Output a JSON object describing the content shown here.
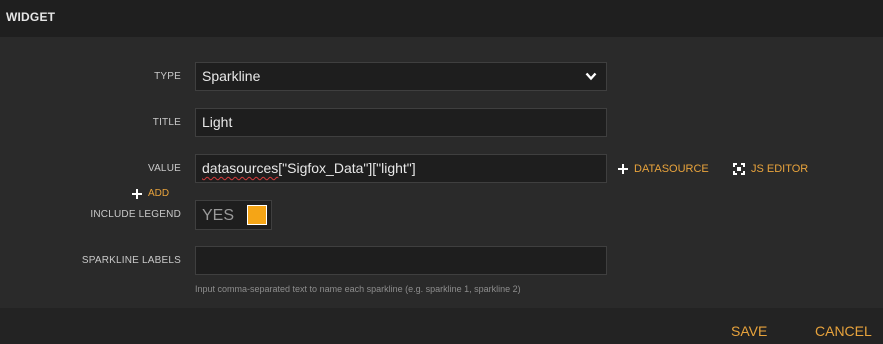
{
  "header": {
    "title": "WIDGET"
  },
  "form": {
    "type": {
      "label": "TYPE",
      "value": "Sparkline"
    },
    "title": {
      "label": "TITLE",
      "value": "Light"
    },
    "value": {
      "label": "VALUE",
      "value_underlined": "datasources",
      "value_rest": "[\"Sigfox_Data\"][\"light\"]",
      "datasource_label": "DATASOURCE",
      "js_editor_label": "JS EDITOR",
      "add_label": "ADD"
    },
    "include_legend": {
      "label": "INCLUDE LEGEND",
      "value": "YES",
      "checked": true
    },
    "sparkline_labels": {
      "label": "SPARKLINE LABELS",
      "value": "",
      "hint": "Input comma-separated text to name each sparkline (e.g. sparkline 1, sparkline 2)"
    }
  },
  "footer": {
    "save_label": "SAVE",
    "cancel_label": "CANCEL"
  },
  "colors": {
    "accent": "#e8a33c",
    "toggle_on": "#f5a516",
    "background": "#2a2a2a"
  },
  "icons": {
    "select_arrow": "chevron-down-icon",
    "datasource": "plus-icon",
    "js_editor": "expand-icon",
    "add": "plus-icon"
  }
}
